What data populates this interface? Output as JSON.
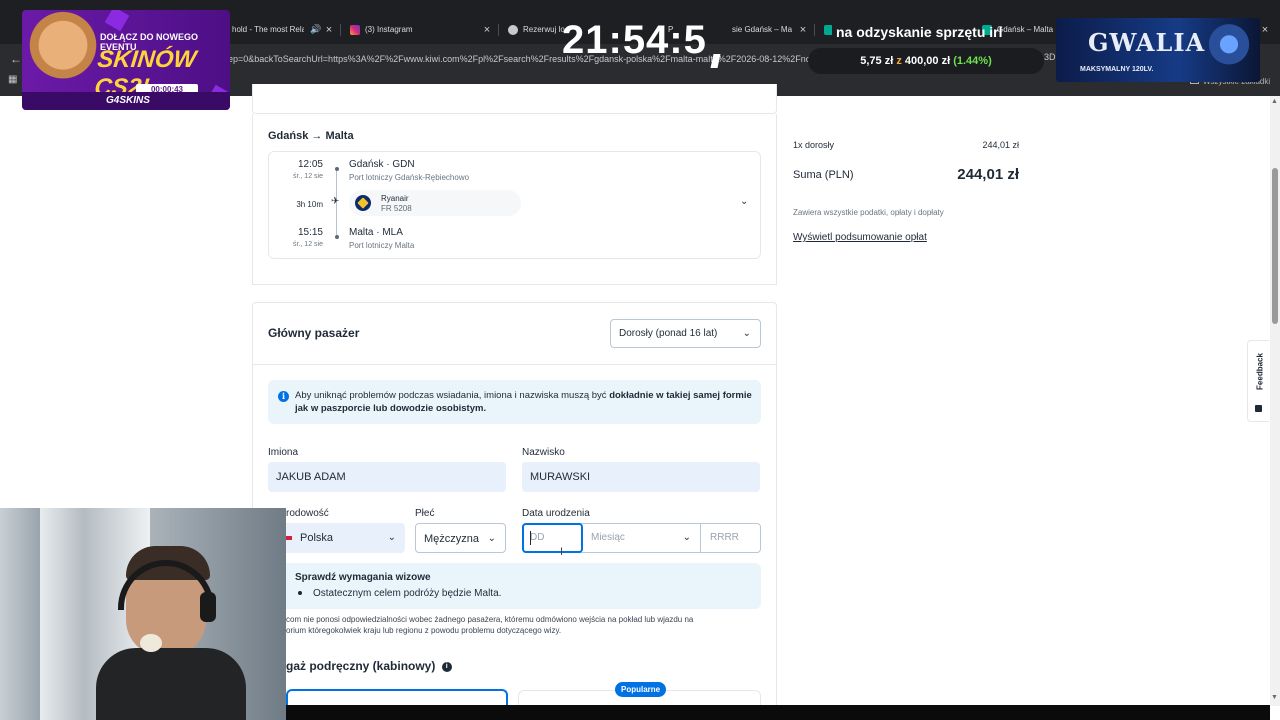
{
  "browser": {
    "tabs": [
      {
        "title": "hold - The most Rela"
      },
      {
        "title": "(3) Instagram"
      },
      {
        "title": "Rezerwuj lo"
      },
      {
        "title": "P"
      },
      {
        "title": "sie Gdańsk – Ma"
      },
      {
        "title": "Gdańsk – Malta"
      }
    ],
    "url": "ep=0&backToSearchUrl=https%3A%2F%2Fwww.kiwi.com%2Fpl%2Fsearch%2Fresults%2Fgdansk-polska%2Fmalta-malta%2F2026-08-12%2Fno-return%3F",
    "url_tail": "3Dproduct%",
    "bookmarks_label": "Wszystkie zakładki"
  },
  "overlays": {
    "clock": "21:54:5",
    "donation_text": "na odzyskanie sprzętu irl",
    "ticker": {
      "current": "5,75 zł",
      "sep": "z",
      "goal": "400,00 zł",
      "pct": "(1.44%)"
    },
    "promo": {
      "line1": "DOŁĄCZ DO NOWEGO EVENTU",
      "line2": "SKINÓW CS2!",
      "timer": "00:00:43",
      "brand": "G4SKINS"
    },
    "gwalia": {
      "title": "GWALIA",
      "subtitle": "MAKSYMALNY 120LV."
    }
  },
  "flight": {
    "route_title": "Gdańsk → Malta",
    "departure": {
      "time": "12:05",
      "date": "śr., 12 sie",
      "city": "Gdańsk · GDN",
      "airport": "Port lotniczy Gdańsk-Rębiechowo"
    },
    "duration": "3h 10m",
    "airline": {
      "name": "Ryanair",
      "flight_no": "FR 5208"
    },
    "arrival": {
      "time": "15:15",
      "date": "śr., 12 sie",
      "city": "Malta · MLA",
      "airport": "Port lotniczy Malta"
    }
  },
  "summary": {
    "line_label": "1x dorosły",
    "line_value": "244,01 zł",
    "total_label": "Suma (PLN)",
    "total_value": "244,01 zł",
    "taxes_note": "Zawiera wszystkie podatki, opłaty i dopłaty",
    "fees_link": "Wyświetl podsumowanie opłat"
  },
  "passenger": {
    "title": "Główny pasażer",
    "type_select": "Dorosły (ponad 16 lat)",
    "notice_text": "Aby uniknąć problemów podczas wsiadania, imiona i nazwiska muszą być ",
    "notice_bold": "dokładnie w takiej samej formie jak w paszporcie lub dowodzie osobistym.",
    "first_name_label": "Imiona",
    "first_name_value": "JAKUB ADAM",
    "last_name_label": "Nazwisko",
    "last_name_value": "MURAWSKI",
    "nationality_label": "rodowość",
    "nationality_value": "Polska",
    "gender_label": "Płeć",
    "gender_value": "Mężczyzna",
    "dob_label": "Data urodzenia",
    "dob_day_placeholder": "DD",
    "dob_month_placeholder": "Miesiąc",
    "dob_year_placeholder": "RRRR",
    "visa_title": "Sprawdź wymagania wizowe",
    "visa_item": "Ostatecznym celem podróży będzie Malta.",
    "disclaimer_line1": "com nie ponosi odpowiedzialności wobec żadnego pasażera, któremu odmówiono wejścia na pokład lub wjazdu na",
    "disclaimer_line2": "orium któregokolwiek kraju lub regionu z powodu problemu dotyczącego wizy."
  },
  "baggage": {
    "title": "gaż podręczny (kabinowy)",
    "popular_badge": "Popularne"
  },
  "feedback_label": "Feedback",
  "colors": {
    "accent": "#0172e4",
    "notice_bg": "#e9f4fb",
    "filled_input": "#e8f1fb",
    "badge": "#0172e4"
  }
}
